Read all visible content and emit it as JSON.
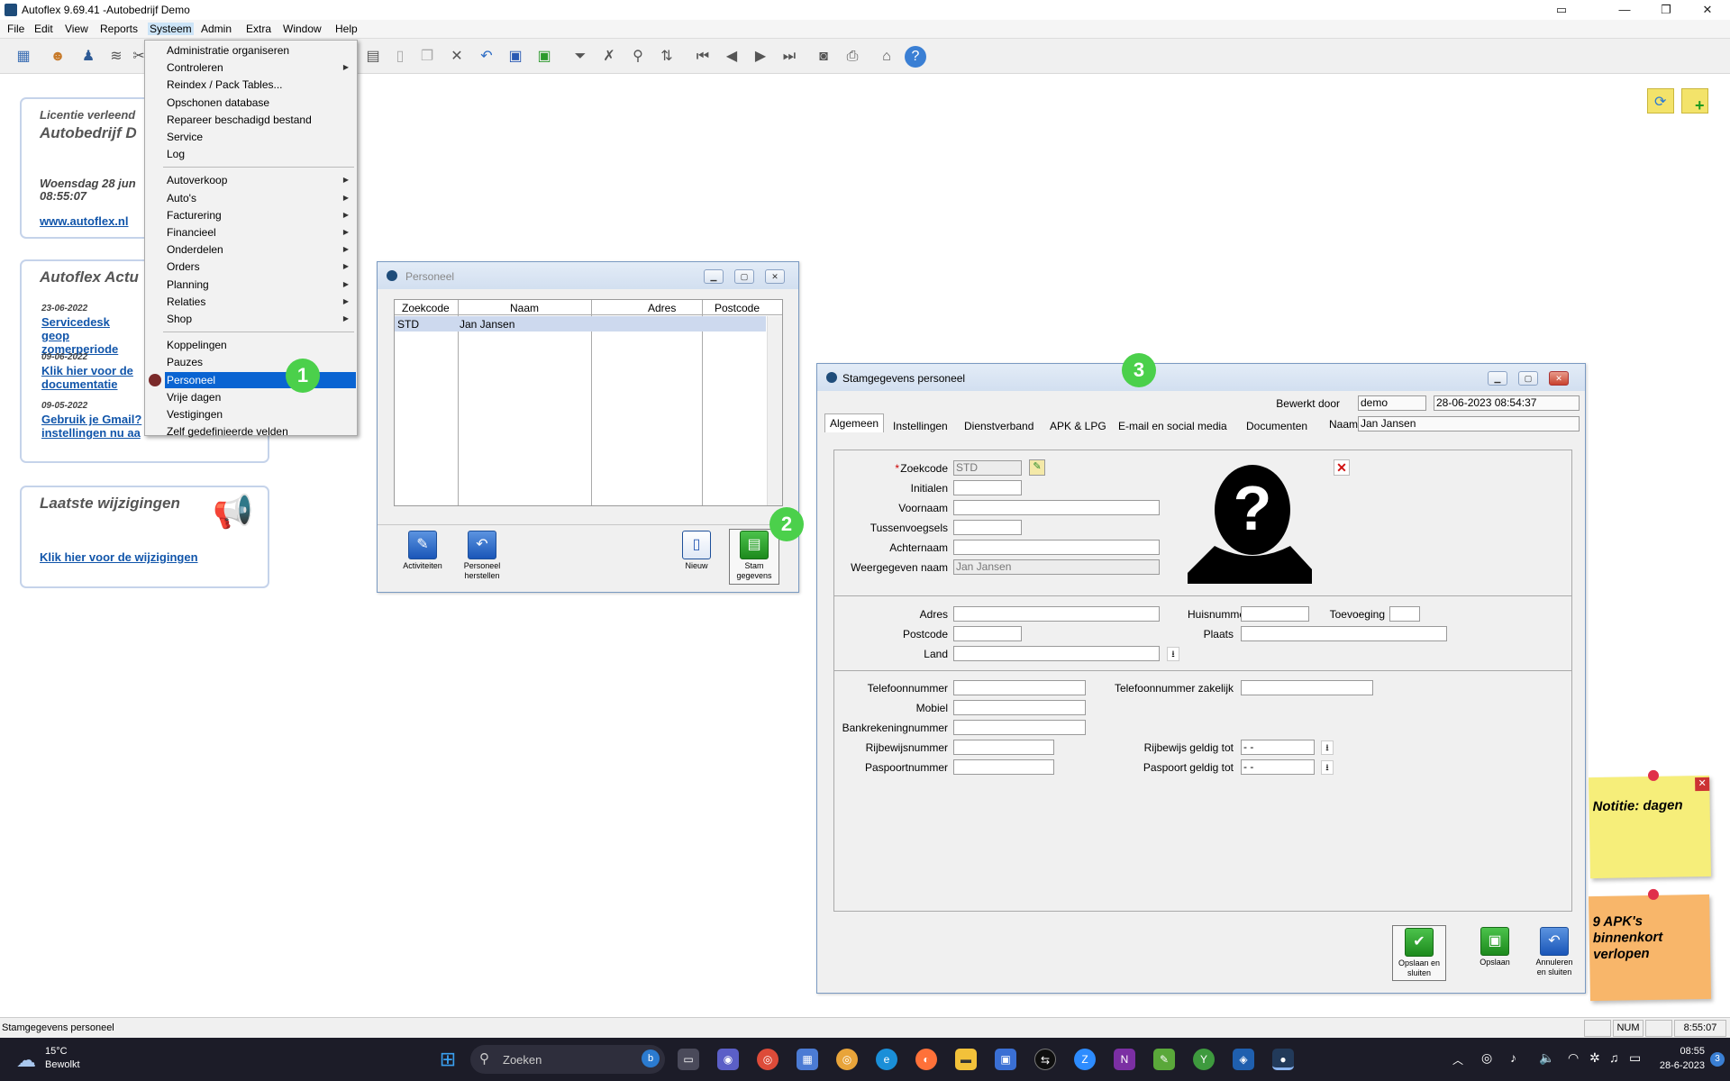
{
  "window": {
    "title": "Autoflex 9.69.41 -Autobedrijf Demo"
  },
  "menubar": [
    "File",
    "Edit",
    "View",
    "Reports",
    "Systeem",
    "Admin",
    "Extra",
    "Window",
    "Help"
  ],
  "toolbar_icons": [
    "grid-icon",
    "users-icon",
    "person-icon",
    "cars-icon",
    "tools-icon",
    "table-icon",
    "page-icon",
    "copy-icon",
    "cut-icon",
    "undo-icon",
    "save-icon",
    "save-green-icon",
    "filter-icon",
    "clear-filter-icon",
    "search-icon",
    "sort-icon",
    "first-icon",
    "prev-icon",
    "next-icon",
    "last-icon",
    "camera-icon",
    "print-icon",
    "home-icon",
    "help-icon"
  ],
  "dropdown": {
    "items": [
      {
        "label": "Administratie organiseren",
        "sub": false
      },
      {
        "label": "Controleren",
        "sub": true
      },
      {
        "label": "Reindex / Pack Tables...",
        "sub": false
      },
      {
        "label": "Opschonen database",
        "sub": false
      },
      {
        "label": "Repareer beschadigd bestand",
        "sub": false
      },
      {
        "label": "Service",
        "sub": false
      },
      {
        "label": "Log",
        "sub": false
      },
      {
        "label": "Autoverkoop",
        "sub": true
      },
      {
        "label": "Auto's",
        "sub": true
      },
      {
        "label": "Facturering",
        "sub": true
      },
      {
        "label": "Financieel",
        "sub": true
      },
      {
        "label": "Onderdelen",
        "sub": true
      },
      {
        "label": "Orders",
        "sub": true
      },
      {
        "label": "Planning",
        "sub": true
      },
      {
        "label": "Relaties",
        "sub": true
      },
      {
        "label": "Shop",
        "sub": true
      },
      {
        "label": "Koppelingen",
        "sub": false
      },
      {
        "label": "Pauzes",
        "sub": false
      },
      {
        "label": "Personeel",
        "sub": false,
        "selected": true
      },
      {
        "label": "Vrije dagen",
        "sub": false
      },
      {
        "label": "Vestigingen",
        "sub": false
      },
      {
        "label": "Zelf gedefinieerde velden",
        "sub": false
      }
    ]
  },
  "panels": {
    "license": {
      "title1": "Licentie verleend",
      "title2": "Autobedrijf D",
      "date": "Woensdag 28 jun",
      "time": "08:55:07",
      "link": "www.autoflex.nl"
    },
    "news": {
      "title": "Autoflex Actu",
      "items": [
        {
          "date": "23-06-2022",
          "text": "Servicedesk geop zomerperiode"
        },
        {
          "date": "09-06-2022",
          "text": "Klik hier voor de documentatie"
        },
        {
          "date": "09-05-2022",
          "text": "Gebruik je Gmail? instellingen nu aa"
        }
      ]
    },
    "changes": {
      "title": "Laatste wijzigingen",
      "link": "Klik hier voor de wijzigingen"
    }
  },
  "personeel": {
    "title": "Personeel",
    "columns": [
      "Zoekcode",
      "Naam",
      "Adres",
      "Postcode"
    ],
    "rows": [
      [
        "STD",
        "Jan Jansen",
        "",
        ""
      ]
    ],
    "buttons": {
      "activiteiten": "Activiteiten",
      "herstellen1": "Personeel",
      "herstellen2": "herstellen",
      "nieuw": "Nieuw",
      "stam1": "Stam",
      "stam2": "gegevens"
    }
  },
  "stam": {
    "title": "Stamgegevens personeel",
    "bewerkt_label": "Bewerkt door",
    "bewerkt_value": "demo",
    "timestamp": "28-06-2023 08:54:37",
    "tabs": [
      "Algemeen",
      "Instellingen",
      "Dienstverband",
      "APK & LPG",
      "E-mail en social media",
      "Documenten"
    ],
    "naam_label": "Naam",
    "naam_value": "Jan Jansen",
    "zoekcode_star": "*",
    "zoekcode_label": "Zoekcode",
    "zoekcode_value": "STD",
    "initialen": "Initialen",
    "voornaam": "Voornaam",
    "tussenvoegsels": "Tussenvoegsels",
    "achternaam": "Achternaam",
    "weergegeven_label": "Weergegeven naam",
    "weergegeven_value": "Jan Jansen",
    "adres": "Adres",
    "huisnummer": "Huisnummer",
    "toevoeging": "Toevoeging",
    "postcode": "Postcode",
    "plaats": "Plaats",
    "land": "Land",
    "telefoon": "Telefoonnummer",
    "telefoon_zak": "Telefoonnummer zakelijk",
    "mobiel": "Mobiel",
    "bank": "Bankrekeningnummer",
    "rijbewijs": "Rijbewijsnummer",
    "rijbewijs_tot": "Rijbewijs geldig tot",
    "paspoort": "Paspoortnummer",
    "paspoort_tot": "Paspoort geldig tot",
    "date_placeholder": "-  -",
    "btn_save_close1": "Opslaan en",
    "btn_save_close2": "sluiten",
    "btn_save": "Opslaan",
    "btn_cancel1": "Annuleren",
    "btn_cancel2": "en sluiten"
  },
  "badges": [
    "1",
    "2",
    "3"
  ],
  "notes": {
    "note1": "Notitie: dagen",
    "note2": "9 APK's binnenkort verlopen"
  },
  "status": {
    "text": "Stamgegevens personeel",
    "num": "NUM",
    "time": "8:55:07"
  },
  "taskbar": {
    "weather_temp": "15°C",
    "weather_text": "Bewolkt",
    "search": "Zoeken",
    "clock_time": "08:55",
    "clock_date": "28-6-2023",
    "notif": "3"
  }
}
